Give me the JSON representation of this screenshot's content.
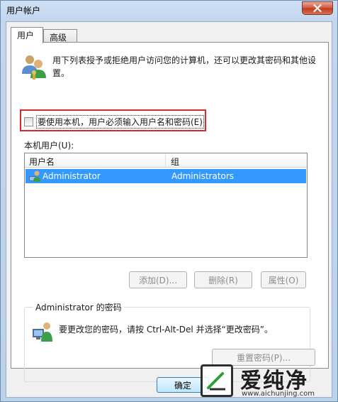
{
  "window": {
    "title": "用户帐户"
  },
  "tabs": [
    {
      "label": "用户"
    },
    {
      "label": "高级"
    }
  ],
  "intro": {
    "text": "用下列表授予或拒绝用户访问您的计算机，还可以更改其密码和其他设置。"
  },
  "require_login": {
    "label": "要使用本机，用户必须输入用户名和密码(E)",
    "checked": false
  },
  "local_users": {
    "label": "本机用户(U):",
    "columns": [
      "用户名",
      "组"
    ],
    "rows": [
      {
        "name": "Administrator",
        "group": "Administrators",
        "selected": true
      }
    ]
  },
  "buttons": {
    "add": "添加(D)...",
    "remove": "删除(R)",
    "properties": "属性(O)",
    "reset_password": "重置密码(P)...",
    "ok": "确定"
  },
  "password_group": {
    "title": "Administrator 的密码",
    "text": "要更改您的密码，请按 Ctrl-Alt-Del 并选择“更改密码”。"
  },
  "watermark": {
    "brand": "爱纯净",
    "url": "www.aichunjing.com"
  },
  "colors": {
    "selection": "#3399ff",
    "highlight_border": "#d52b2b"
  }
}
